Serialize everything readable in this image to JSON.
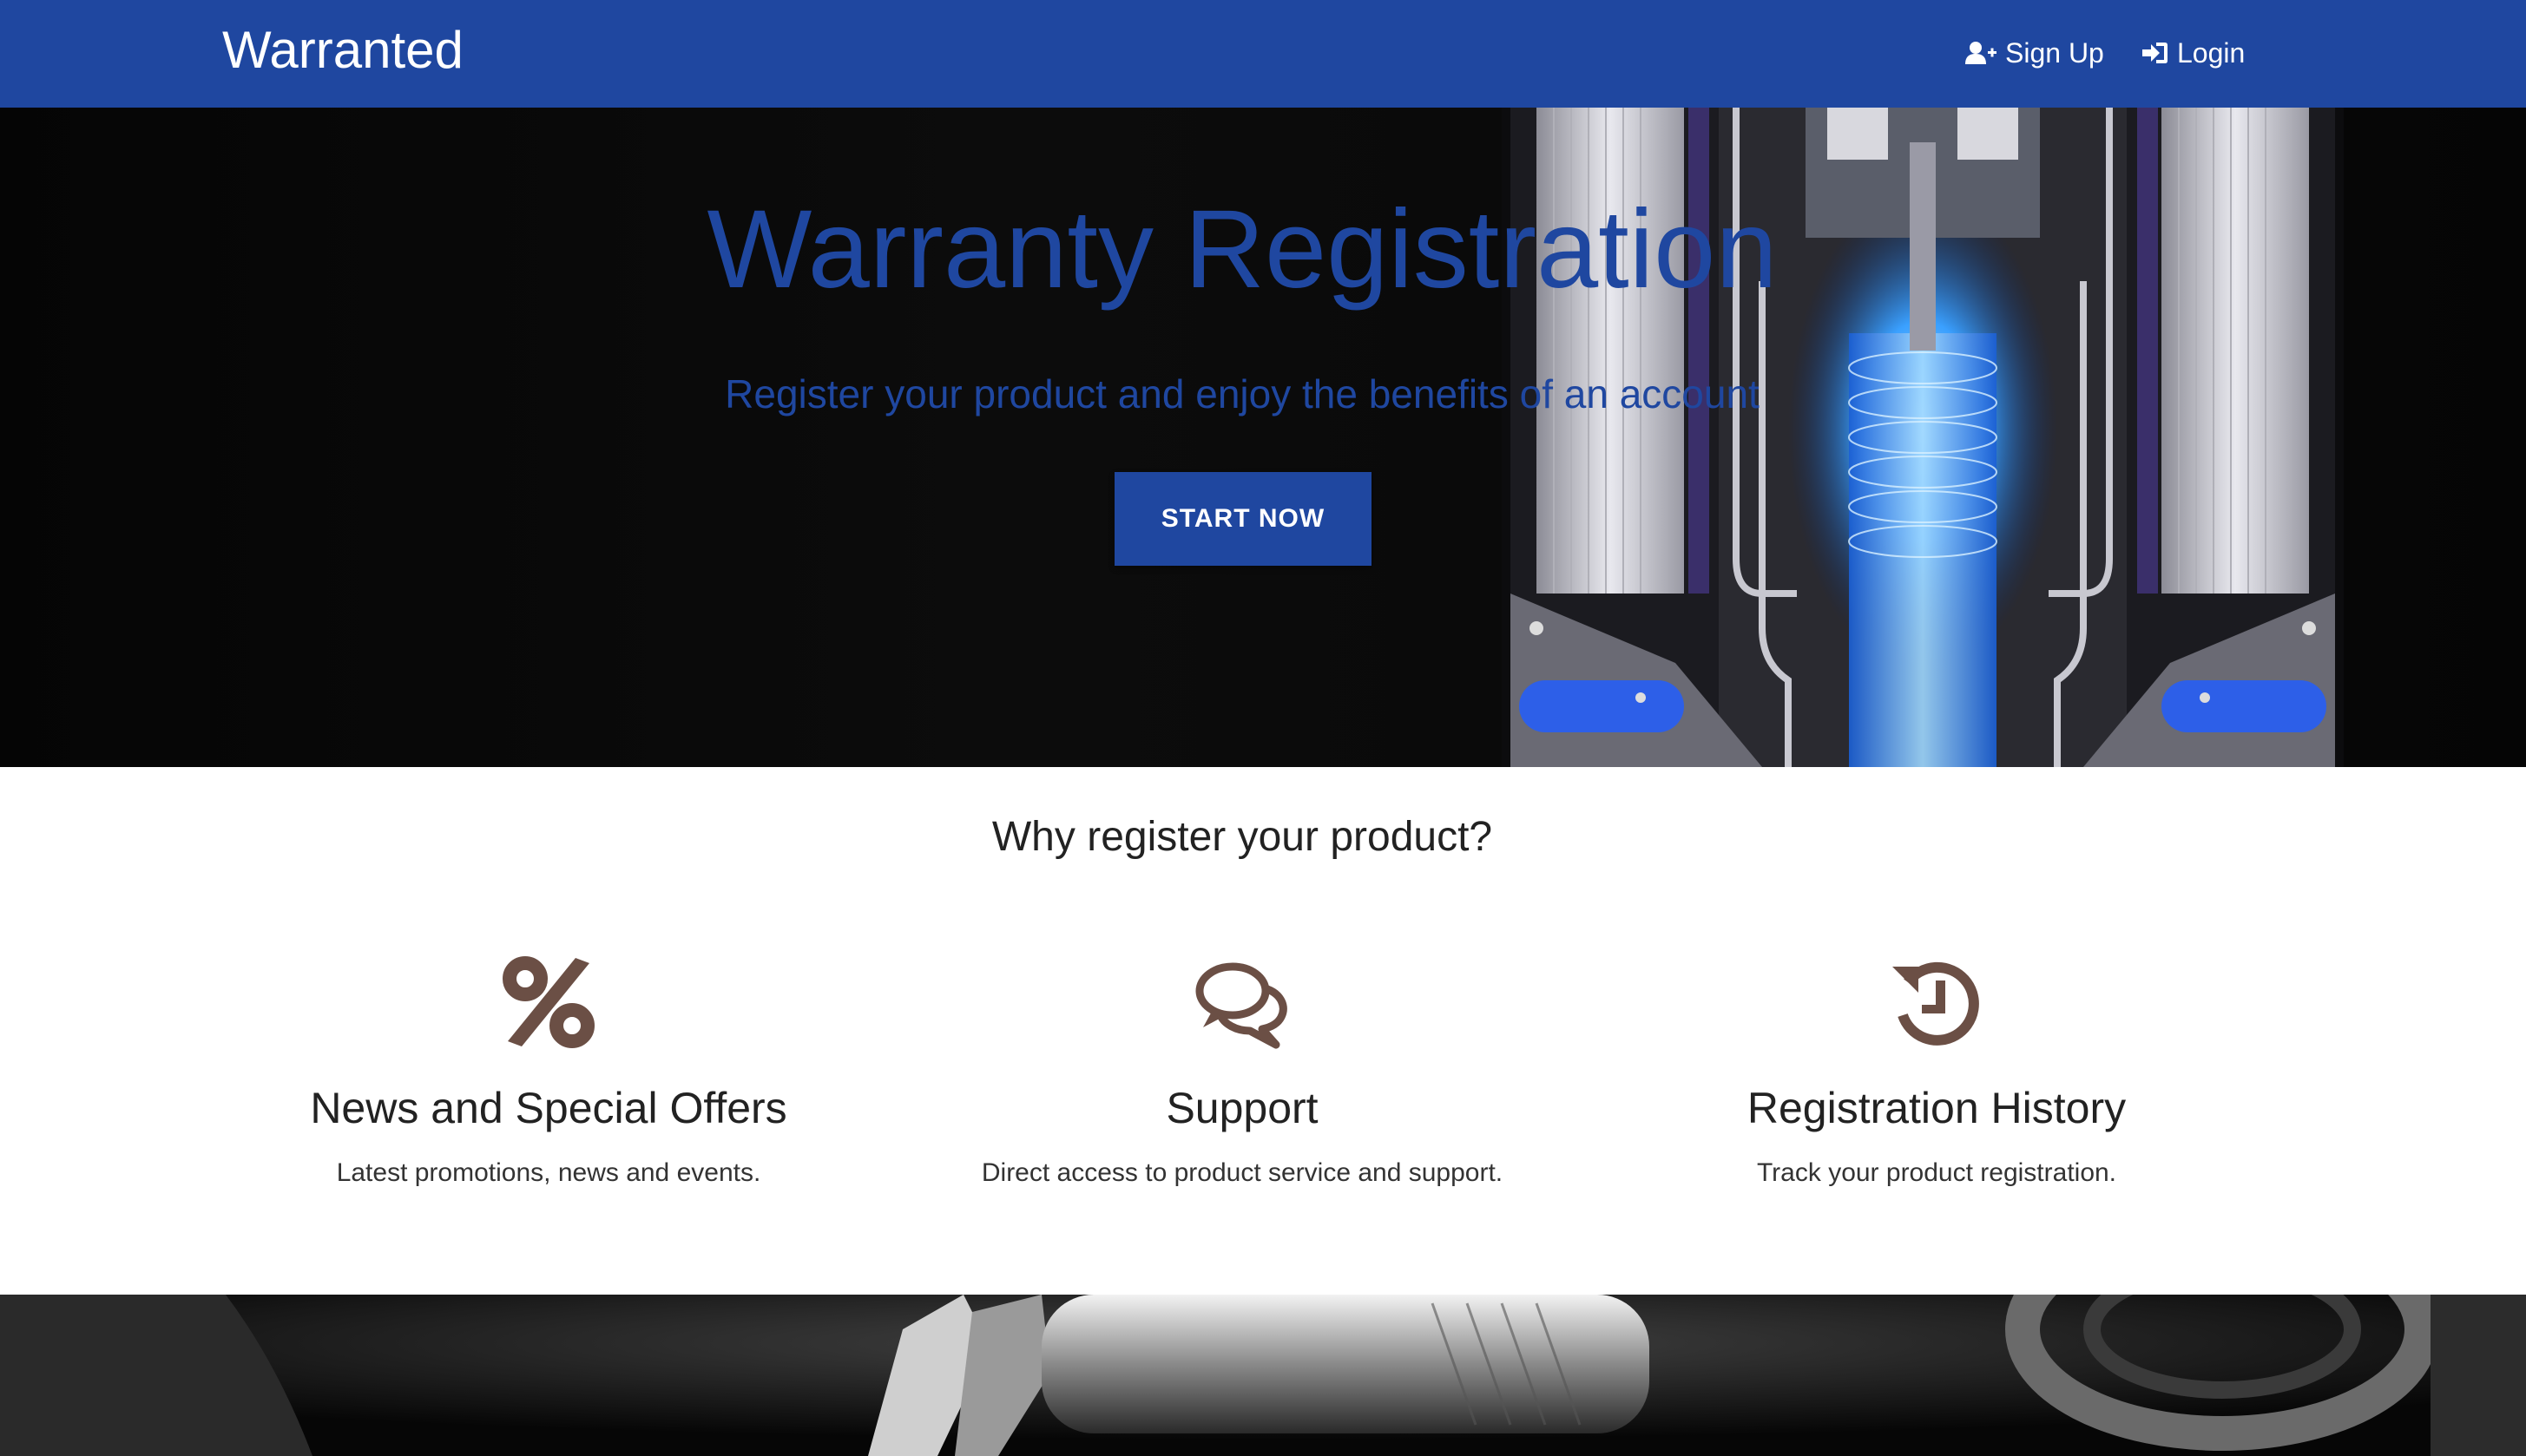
{
  "navbar": {
    "brand": "Warranted",
    "signup_label": "Sign Up",
    "login_label": "Login"
  },
  "hero": {
    "title": "Warranty Registration",
    "subtitle": "Register your product and enjoy the benefits of an account",
    "cta_label": "START NOW"
  },
  "why": {
    "heading": "Why register your product?",
    "features": [
      {
        "icon": "percent-icon",
        "title": "News and Special Offers",
        "description": "Latest promotions, news and events."
      },
      {
        "icon": "comments-icon",
        "title": "Support",
        "description": "Direct access to product service and support."
      },
      {
        "icon": "history-icon",
        "title": "Registration History",
        "description": "Track your product registration."
      }
    ]
  },
  "colors": {
    "brand_blue": "#1f47a0",
    "icon_brown": "#6b4f45",
    "hero_bg": "#0a0a0a"
  }
}
